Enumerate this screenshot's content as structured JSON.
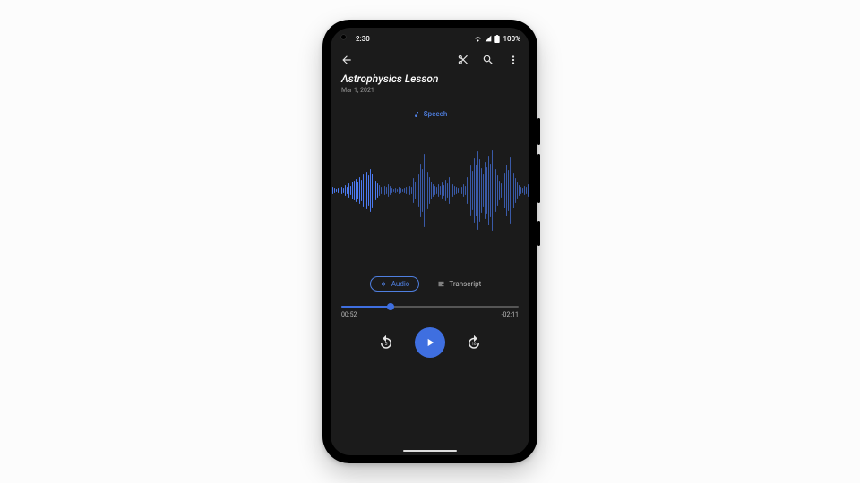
{
  "status": {
    "time": "2:30",
    "battery": "100%"
  },
  "appbar": {},
  "recording": {
    "title": "Astrophysics Lesson",
    "date": "Mar 1, 2021",
    "content_label": "Speech"
  },
  "tabs": {
    "audio": "Audio",
    "transcript": "Transcript",
    "active": "audio"
  },
  "playback": {
    "elapsed": "00:52",
    "remaining": "-02:11",
    "progress_pct": 28
  },
  "colors": {
    "accent": "#3f6fe0",
    "label": "#4f7fe0"
  },
  "waveform": [
    6,
    10,
    8,
    14,
    10,
    18,
    12,
    22,
    14,
    10,
    8,
    6,
    4,
    6,
    4,
    8,
    6,
    12,
    8,
    16,
    10,
    20,
    22,
    26,
    20,
    30,
    24,
    36,
    28,
    42,
    34,
    48,
    38,
    30,
    22,
    16,
    12,
    8,
    6,
    10,
    8,
    14,
    10,
    6,
    4,
    6,
    4,
    8,
    6,
    4,
    6,
    8,
    6,
    10,
    8,
    28,
    20,
    46,
    36,
    60,
    48,
    82,
    64,
    42,
    30,
    20,
    14,
    10,
    8,
    14,
    10,
    18,
    12,
    24,
    16,
    30,
    20,
    14,
    10,
    8,
    6,
    10,
    8,
    14,
    10,
    30,
    38,
    56,
    44,
    72,
    58,
    88,
    70,
    50,
    36,
    64,
    52,
    78,
    60,
    90,
    72,
    48,
    34,
    22,
    16,
    28,
    40,
    58,
    46,
    74,
    60,
    40,
    28,
    18,
    12,
    8,
    6,
    10,
    8,
    14,
    10,
    6,
    4,
    6,
    4,
    8,
    6,
    4,
    6,
    4
  ]
}
